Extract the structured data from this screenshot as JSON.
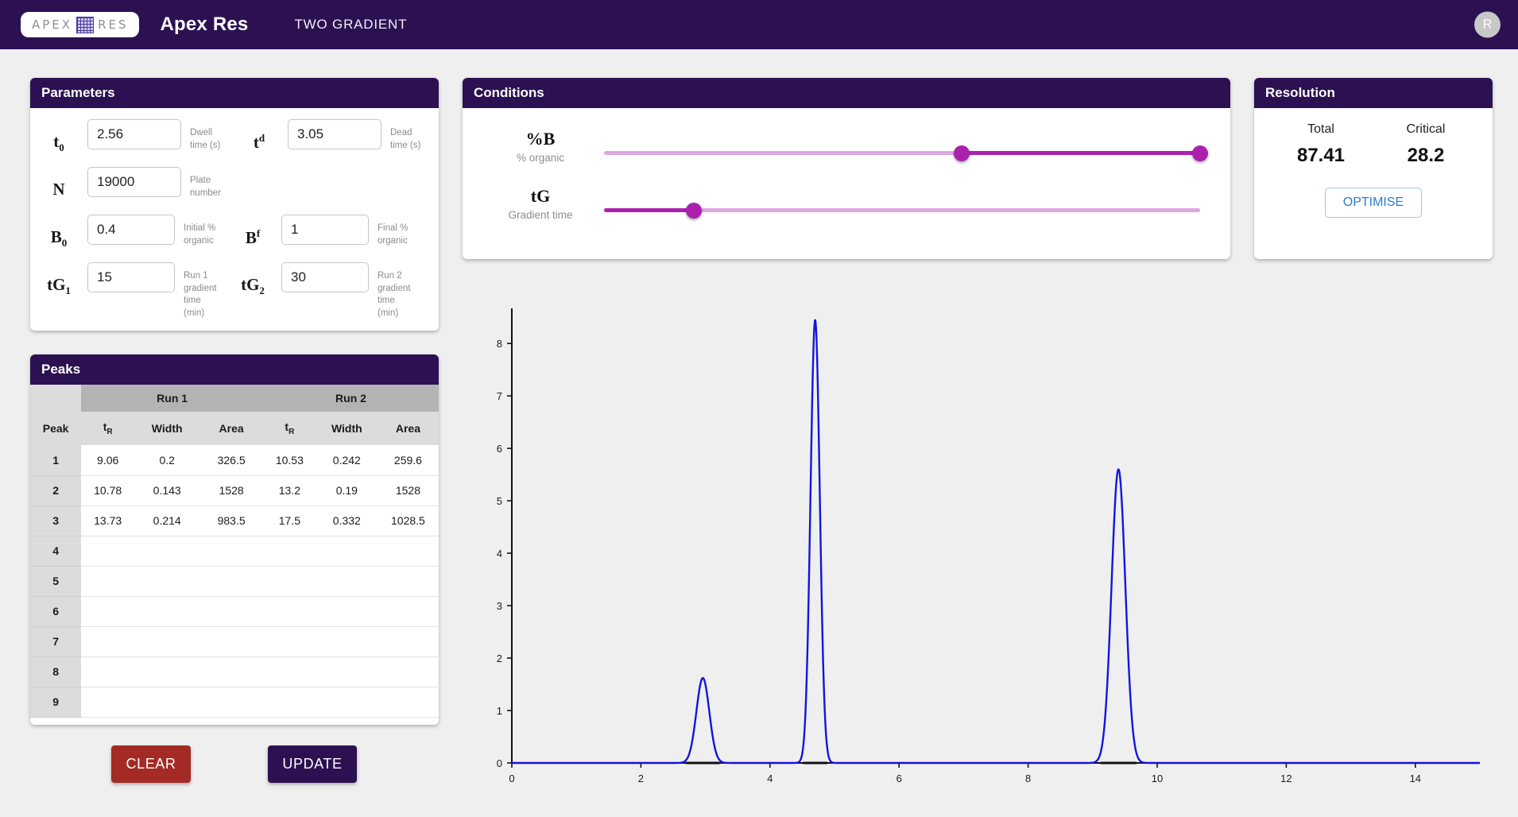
{
  "appbar": {
    "logo_left": "APEX",
    "logo_right": "RES",
    "title": "Apex Res",
    "subtitle": "TWO GRADIENT",
    "avatar_initial": "R"
  },
  "parameters": {
    "heading": "Parameters",
    "fields": [
      {
        "symbol": "t",
        "sub": "0",
        "value": "2.56",
        "hint": "Dwell time (s)"
      },
      {
        "symbol": "t",
        "sup": "d",
        "value": "3.05",
        "hint": "Dead time (s)"
      },
      {
        "symbol": "N",
        "sub": "",
        "value": "19000",
        "hint": "Plate number"
      },
      {
        "symbol": "B",
        "sub": "0",
        "value": "0.4",
        "hint": "Initial % organic"
      },
      {
        "symbol": "B",
        "sup": "f",
        "value": "1",
        "hint": "Final % organic"
      },
      {
        "symbol": "tG",
        "sub": "1",
        "value": "15",
        "hint": "Run 1 gradient time (min)"
      },
      {
        "symbol": "tG",
        "sub": "2",
        "value": "30",
        "hint": "Run 2 gradient time (min)"
      }
    ]
  },
  "conditions": {
    "heading": "Conditions",
    "sliders": [
      {
        "symbol": "%B",
        "caption": "% organic",
        "type": "range",
        "low_pct": 60,
        "high_pct": 100
      },
      {
        "symbol": "tG",
        "caption": "Gradient time",
        "type": "single",
        "value_pct": 15
      }
    ]
  },
  "resolution": {
    "heading": "Resolution",
    "total_label": "Total",
    "total_value": "87.41",
    "critical_label": "Critical",
    "critical_value": "28.2",
    "optimise_label": "OPTIMISE"
  },
  "peaks": {
    "heading": "Peaks",
    "group_headers": [
      "",
      "Run 1",
      "Run 2"
    ],
    "columns": [
      "Peak",
      "tR",
      "Width",
      "Area",
      "tR",
      "Width",
      "Area"
    ],
    "rows": [
      {
        "peak": "1",
        "r1_tr": "9.06",
        "r1_w": "0.2",
        "r1_a": "326.5",
        "r2_tr": "10.53",
        "r2_w": "0.242",
        "r2_a": "259.6"
      },
      {
        "peak": "2",
        "r1_tr": "10.78",
        "r1_w": "0.143",
        "r1_a": "1528",
        "r2_tr": "13.2",
        "r2_w": "0.19",
        "r2_a": "1528"
      },
      {
        "peak": "3",
        "r1_tr": "13.73",
        "r1_w": "0.214",
        "r1_a": "983.5",
        "r2_tr": "17.5",
        "r2_w": "0.332",
        "r2_a": "1028.5"
      },
      {
        "peak": "4",
        "r1_tr": "",
        "r1_w": "",
        "r1_a": "",
        "r2_tr": "",
        "r2_w": "",
        "r2_a": ""
      },
      {
        "peak": "5",
        "r1_tr": "",
        "r1_w": "",
        "r1_a": "",
        "r2_tr": "",
        "r2_w": "",
        "r2_a": ""
      },
      {
        "peak": "6",
        "r1_tr": "",
        "r1_w": "",
        "r1_a": "",
        "r2_tr": "",
        "r2_w": "",
        "r2_a": ""
      },
      {
        "peak": "7",
        "r1_tr": "",
        "r1_w": "",
        "r1_a": "",
        "r2_tr": "",
        "r2_w": "",
        "r2_a": ""
      },
      {
        "peak": "8",
        "r1_tr": "",
        "r1_w": "",
        "r1_a": "",
        "r2_tr": "",
        "r2_w": "",
        "r2_a": ""
      },
      {
        "peak": "9",
        "r1_tr": "",
        "r1_w": "",
        "r1_a": "",
        "r2_tr": "",
        "r2_w": "",
        "r2_a": ""
      }
    ]
  },
  "actions": {
    "clear_label": "CLEAR",
    "update_label": "UPDATE"
  },
  "colors": {
    "brand_dark": "#2c1152",
    "slider": "#ab21ae",
    "slider_track": "#dca8e2",
    "clear": "#a32a25",
    "trace": "#1414e0",
    "page_bg": "#efefef"
  },
  "chart_data": {
    "type": "line",
    "title": "",
    "xlabel": "",
    "ylabel": "",
    "xlim": [
      0,
      15.0
    ],
    "ylim": [
      0,
      8.67
    ],
    "xticks": [
      0,
      2,
      4,
      6,
      8,
      10,
      12,
      14
    ],
    "yticks": [
      0,
      1,
      2,
      3,
      4,
      5,
      6,
      7,
      8
    ],
    "grid": false,
    "legend": false,
    "series": [
      {
        "name": "chromatogram",
        "color": "#1414e0",
        "peaks": [
          {
            "center": 2.96,
            "height": 1.62,
            "width": 0.1
          },
          {
            "center": 4.7,
            "height": 8.45,
            "width": 0.072
          },
          {
            "center": 9.4,
            "height": 5.6,
            "width": 0.107
          }
        ]
      }
    ]
  }
}
